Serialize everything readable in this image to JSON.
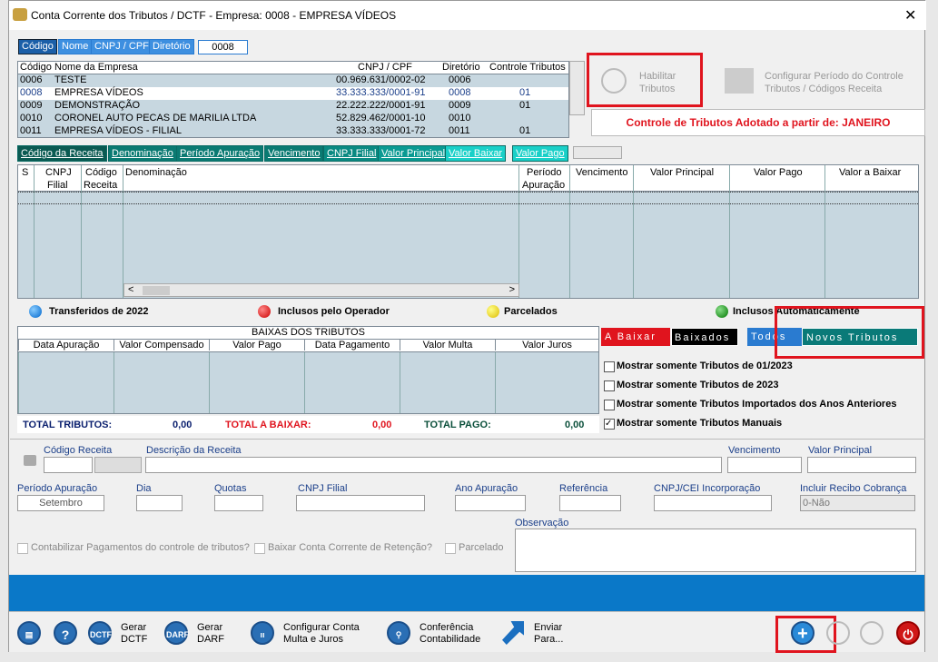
{
  "window": {
    "title": "Conta Corrente dos Tributos / DCTF   -   Empresa: 0008 - EMPRESA VÍDEOS",
    "close": "✕"
  },
  "search_tabs": [
    "Código",
    "Nome",
    "CNPJ / CPF",
    "Diretório"
  ],
  "search_value": "0008",
  "companies": {
    "headers": [
      "Código",
      "Nome da Empresa",
      "CNPJ / CPF",
      "Diretório",
      "Controle Tributos"
    ],
    "rows": [
      [
        "0006",
        "TESTE",
        "00.969.631/0002-02",
        "0006",
        ""
      ],
      [
        "0008",
        "EMPRESA VÍDEOS",
        "33.333.333/0001-91",
        "0008",
        "01"
      ],
      [
        "0009",
        "DEMONSTRAÇÃO",
        "22.222.222/0001-91",
        "0009",
        "01"
      ],
      [
        "0010",
        "CORONEL AUTO PECAS DE MARILIA LTDA",
        "52.829.462/0001-10",
        "0010",
        ""
      ],
      [
        "0011",
        "EMPRESA VÍDEOS - FILIAL",
        "33.333.333/0001-72",
        "0011",
        "01"
      ]
    ]
  },
  "habilitar": "Habilitar\nTributos",
  "configurar": "Configurar Período do Controle\nTributos / Códigos Receita",
  "controle_msg": "Controle de Tributos Adotado a partir de: JANEIRO",
  "sort_tabs": [
    "Código da Receita",
    "Denominação",
    "Período Apuração",
    "Vencimento",
    "CNPJ Filial",
    "Valor Principal",
    "Valor Baixar",
    "Valor Pago"
  ],
  "tributos_headers": {
    "s": "S",
    "cnpj": "CNPJ",
    "filial": "Filial",
    "codigo": "Código",
    "receita": "Receita",
    "denominacao": "Denominação",
    "periodo": "Período",
    "apuracao": "Apuração",
    "vencimento": "Vencimento",
    "valor_principal": "Valor Principal",
    "valor_pago": "Valor Pago",
    "valor_baixar": "Valor a Baixar"
  },
  "legend": {
    "blue": "Transferidos de 2022",
    "red": "Inclusos pelo Operador",
    "yellow": "Parcelados",
    "green": "Inclusos Automaticamente"
  },
  "baixas": {
    "title": "BAIXAS DOS TRIBUTOS",
    "headers": [
      "Data Apuração",
      "Valor Compensado",
      "Valor Pago",
      "Data Pagamento",
      "Valor Multa",
      "Valor Juros"
    ]
  },
  "totals": {
    "tributos_label": "TOTAL TRIBUTOS:",
    "tributos": "0,00",
    "baixar_label": "TOTAL A BAIXAR:",
    "baixar": "0,00",
    "pago_label": "TOTAL PAGO:",
    "pago": "0,00"
  },
  "filter_tabs": [
    "A Baixar",
    "Baixados",
    "Todos",
    "Novos Tributos"
  ],
  "checks": [
    {
      "label": "Mostrar somente Tributos de 01/2023",
      "checked": false
    },
    {
      "label": "Mostrar somente Tributos de 2023",
      "checked": false
    },
    {
      "label": "Mostrar somente Tributos Importados dos Anos Anteriores",
      "checked": false
    },
    {
      "label": "Mostrar somente Tributos Manuais",
      "checked": true
    }
  ],
  "form": {
    "codigo_receita": "Código Receita",
    "descricao": "Descrição da Receita",
    "vencimento": "Vencimento",
    "valor_principal": "Valor Principal",
    "periodo": "Período Apuração",
    "periodo_value": "Setembro",
    "dia": "Dia",
    "quotas": "Quotas",
    "cnpj_filial": "CNPJ Filial",
    "ano": "Ano Apuração",
    "referencia": "Referência",
    "cnpj_cei": "CNPJ/CEI Incorporação",
    "incluir": "Incluir Recibo Cobrança",
    "incluir_value": "0-Não",
    "observacao": "Observação",
    "contabilizar": "Contabilizar Pagamentos do controle de tributos?",
    "baixar_conta": "Baixar Conta Corrente de Retenção?",
    "parcelado": "Parcelado"
  },
  "toolbar": {
    "gerar_dctf": "Gerar\nDCTF",
    "gerar_darf": "Gerar\nDARF",
    "configurar_conta": "Configurar Conta\nMulta  e  Juros",
    "conferencia": "Conferência\nContabilidade",
    "enviar": "Enviar\nPara...",
    "dctf_icon": "DCTF",
    "darf_icon": "DARF"
  }
}
